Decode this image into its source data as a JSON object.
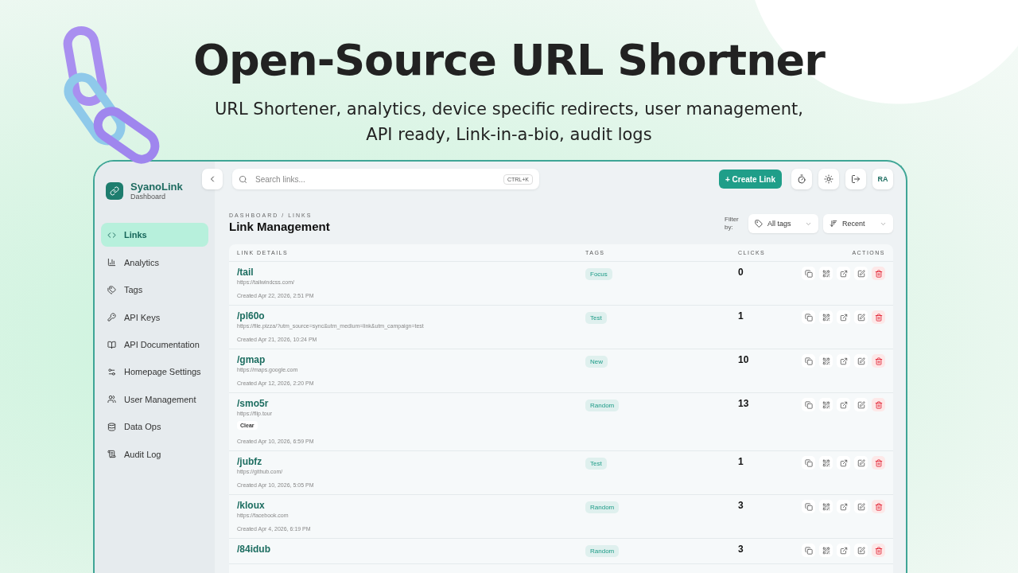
{
  "hero": {
    "title": "Open-Source URL Shortner",
    "subtitle_lines": [
      "URL Shortener, analytics, device specific redirects, user management,",
      "API ready, Link-in-a-bio, audit logs"
    ]
  },
  "app": {
    "brand": {
      "name": "SyanoLink",
      "subtitle": "Dashboard"
    },
    "sidebar": {
      "items": [
        {
          "label": "Links",
          "selected": true
        },
        {
          "label": "Analytics",
          "selected": false
        },
        {
          "label": "Tags",
          "selected": false
        },
        {
          "label": "API Keys",
          "selected": false
        },
        {
          "label": "API Documentation",
          "selected": false
        },
        {
          "label": "Homepage Settings",
          "selected": false
        },
        {
          "label": "User Management",
          "selected": false
        },
        {
          "label": "Data Ops",
          "selected": false
        },
        {
          "label": "Audit Log",
          "selected": false
        }
      ]
    },
    "search": {
      "placeholder": "Search links...",
      "shortcut": "CTRL+K"
    },
    "create_button": "+ Create Link",
    "avatar": "RA",
    "breadcrumb": "DASHBOARD / LINKS",
    "title": "Link Management",
    "filter": {
      "label": "Filter by:",
      "tags": "All tags",
      "sort": "Recent"
    },
    "table": {
      "columns": [
        "LINK DETAILS",
        "TAGS",
        "CLICKS",
        "ACTIONS"
      ],
      "rows": [
        {
          "slug": "/tail",
          "url": "https://tailwindcss.com/",
          "created": "Created Apr 22, 2026, 2:51 PM",
          "tag": "Focus",
          "clicks": "0"
        },
        {
          "slug": "/pl60o",
          "url": "https://file.pizza/?utm_source=sync&utm_medium=link&utm_campaign=test",
          "created": "Created Apr 21, 2026, 10:24 PM",
          "tag": "Test",
          "clicks": "1"
        },
        {
          "slug": "/gmap",
          "url": "https://maps.google.com",
          "created": "Created Apr 12, 2026, 2:20 PM",
          "tag": "New",
          "clicks": "10"
        },
        {
          "slug": "/smo5r",
          "url": "https://flip.tour",
          "chip": "Clear",
          "created": "Created Apr 10, 2026, 6:59 PM",
          "tag": "Random",
          "clicks": "13"
        },
        {
          "slug": "/jubfz",
          "url": "https://github.com/",
          "created": "Created Apr 10, 2026, 5:05 PM",
          "tag": "Test",
          "clicks": "1"
        },
        {
          "slug": "/kloux",
          "url": "https://facebook.com",
          "created": "Created Apr 4, 2026, 6:19 PM",
          "tag": "Random",
          "clicks": "3"
        },
        {
          "slug": "/84idub",
          "tag": "Random",
          "clicks": "3"
        }
      ]
    }
  }
}
